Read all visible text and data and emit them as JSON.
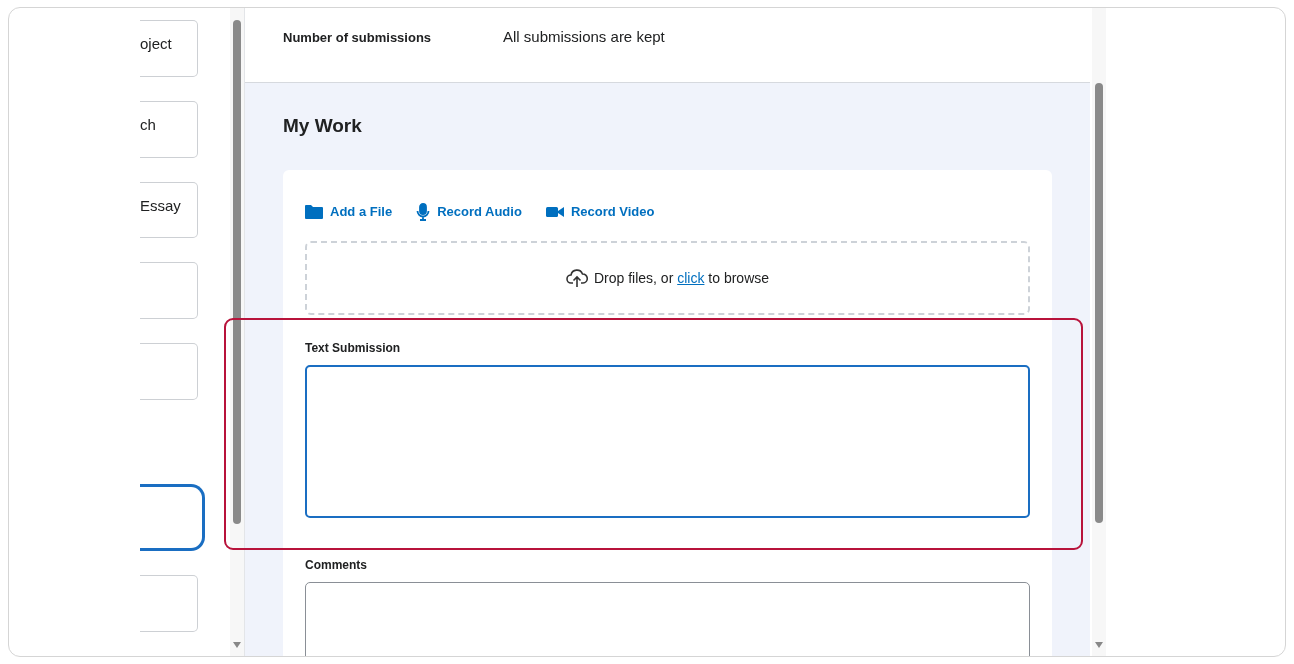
{
  "sidebar": {
    "items": [
      {
        "label": "oject",
        "selected": false
      },
      {
        "label": "ch",
        "selected": false
      },
      {
        "label": "Essay",
        "selected": false
      },
      {
        "selected": false
      },
      {
        "selected": false
      },
      {
        "selected": true
      },
      {
        "selected": false
      }
    ]
  },
  "details": [
    {
      "label": "Number of submissions",
      "value": "All submissions are kept"
    }
  ],
  "my_work": {
    "title": "My Work",
    "actions": [
      {
        "kind": "file",
        "label": "Add a File"
      },
      {
        "kind": "audio",
        "label": "Record Audio"
      },
      {
        "kind": "video",
        "label": "Record Video"
      }
    ],
    "dropzone": {
      "before": "Drop files, or ",
      "link": "click",
      "after": " to browse"
    },
    "fields": [
      {
        "label": "Text Submission",
        "focused": true,
        "highlighted": true
      },
      {
        "label": "Comments",
        "focused": false,
        "highlighted": false
      }
    ]
  }
}
